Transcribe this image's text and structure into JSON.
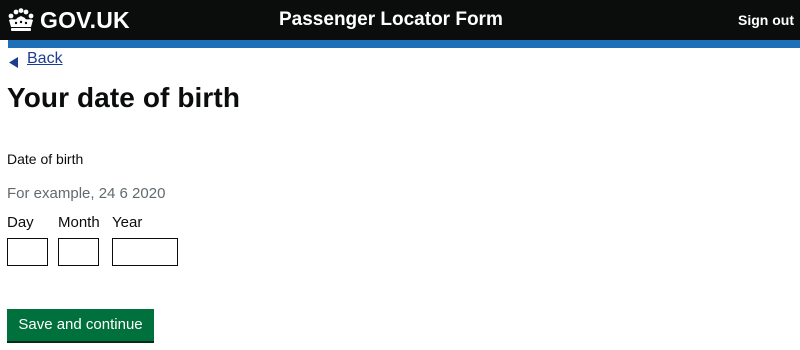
{
  "header": {
    "logo_text": "GOV.UK",
    "logo_icon": "crown-icon",
    "service_name": "Passenger Locator Form",
    "sign_out_label": "Sign out"
  },
  "navigation": {
    "back_label": "Back",
    "back_icon": "chevron-left-icon"
  },
  "main": {
    "title": "Your date of birth",
    "field_label": "Date of birth",
    "hint": "For example, 24 6 2020",
    "date_fields": [
      {
        "label": "Day",
        "value": ""
      },
      {
        "label": "Month",
        "value": ""
      },
      {
        "label": "Year",
        "value": ""
      }
    ],
    "submit_label": "Save and continue"
  },
  "colors": {
    "header_background": "#0b0c0c",
    "header_bar": "#1d70b8",
    "link": "#1d3d8f",
    "hint_text": "#626a6e",
    "button_background": "#00703c"
  }
}
